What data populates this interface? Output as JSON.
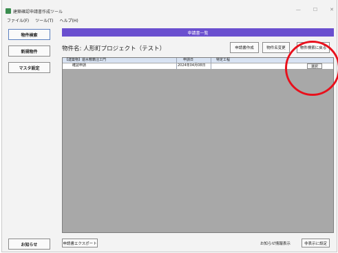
{
  "window": {
    "title": "建築確認申請書作成ツール",
    "minimize_glyph": "—",
    "maximize_glyph": "☐",
    "close_glyph": "✕",
    "accent_color": "#6a4fcf"
  },
  "menu": [
    "ファイル(F)",
    "ツール(T)",
    "ヘルプ(H)"
  ],
  "sidebar": {
    "items": [
      "物件検索",
      "新規物件",
      "マスタ設定"
    ],
    "bottom": "お知らせ"
  },
  "main": {
    "header": "申請書一覧",
    "project_name": "物件名: 人形町プロジェクト（テスト）",
    "buttons": [
      "申請書作成",
      "物件名変更",
      "物件検索に戻る"
    ],
    "columns": [
      "【建築物】遊水敷籍注工門",
      "申請日",
      "特定工程"
    ],
    "rows": [
      {
        "name": "確認申請",
        "date": "2024年04月08日",
        "process": "",
        "action": "選択"
      }
    ],
    "export_button": "申請書エクスポート",
    "notice_label": "お知らせ情報表示",
    "settings_button": "非表示に設定"
  }
}
